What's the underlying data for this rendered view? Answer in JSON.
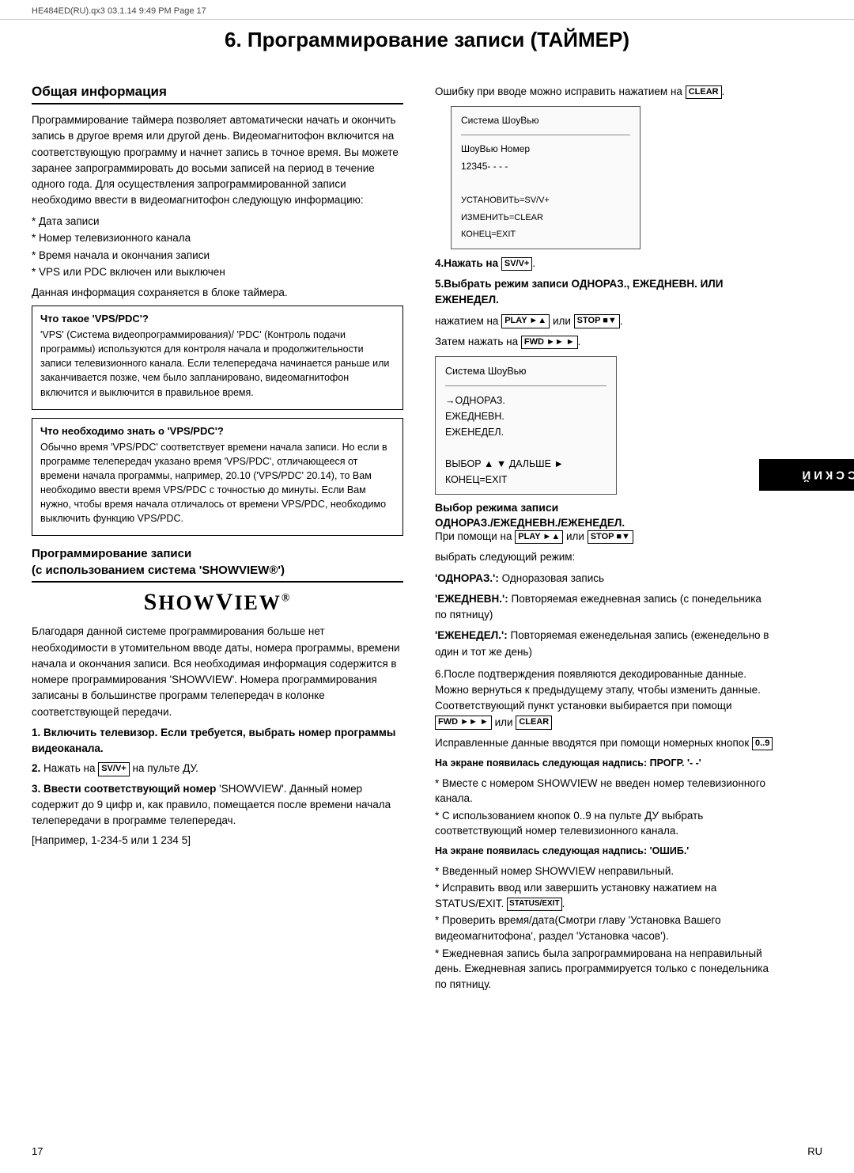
{
  "header": {
    "left": "HE484ED(RU).qx3  03.1.14  9:49 PM  Page 17",
    "right": ""
  },
  "chapter_title": "6. Программирование записи (ТАЙМЕР)",
  "left_col": {
    "section1_heading": "Общая информация",
    "section1_text": "Программирование таймера позволяет автоматически начать и окончить запись в другое время или другой день. Видеомагнитофон включится на соответствующую программу и начнет запись в точное время. Вы можете заранее запрограммировать до восьми записей на период в течение одного года. Для осуществления запрограммированной записи необходимо ввести в видеомагнитофон следующую информацию:",
    "star_items": [
      "Дата записи",
      "Номер телевизионного канала",
      "Время начала и окончания записи",
      "VPS или PDC включен или выключен"
    ],
    "section1_note": "Данная информация сохраняется в блоке таймера.",
    "subbox1_title": "Что такое 'VPS/PDC'?",
    "subbox1_text": "'VPS' (Система видеопрограммирования)/ 'PDC' (Контроль подачи программы) используются для контроля начала и продолжительности записи телевизионного канала. Если телепередача начинается раньше или заканчивается позже, чем было запланировано, видеомагнитофон включится и выключится в правильное время.",
    "subbox2_title": "Что необходимо знать о 'VPS/PDC'?",
    "subbox2_text": "Обычно время 'VPS/PDC' соответствует времени начала записи. Но если в программе телепередач указано время 'VPS/PDC', отличающееся от времени начала программы, например, 20.10 ('VPS/PDC' 20.14), то Вам необходимо ввести время VPS/PDC с точностью до минуты. Если Вам нужно, чтобы время начала отличалось от времени VPS/PDC, необходимо выключить функцию VPS/PDC.",
    "prog_section_title1": "Программирование записи",
    "prog_section_title2": "(с использованием система 'SHOWVIEW®')",
    "showview_logo": "ShowView",
    "showview_text": "Благодаря данной системе программирования больше нет необходимости в утомительном вводе даты, номера программы, времени начала и окончания записи. Вся необходимая информация содержится в номере программирования 'SHOWVIEW'. Номера программирования записаны в большинстве программ телепередач в колонке соответствующей передачи.",
    "steps": [
      {
        "num": "1.",
        "bold": "Включить телевизор. Если требуется, выбрать номер программы видеоканала."
      },
      {
        "num": "2.",
        "text_before_key": "Нажать на ",
        "key": "SV/V+",
        "text_after_key": " на пульте ДУ."
      },
      {
        "num": "3.",
        "bold": "Ввести соответствующий номер",
        "text": "'SHOWVIEW'. Данный номер содержит до 9 цифр и, как правило, помещается после времени начала телепередачи в программе телепередач."
      },
      {
        "num": "example",
        "text": "[Например, 1-234-5 или 1 234 5]"
      }
    ]
  },
  "right_col": {
    "clear_intro": "Ошибку при вводе можно исправить нажатием на",
    "clear_key": "CLEAR",
    "screen1": {
      "title": "Система ШоуВью",
      "line1": "ШоуВью Номер",
      "line2": "12345- - - -",
      "line3": "",
      "line4": "УСТАНОВИТЬ=SV/V+",
      "line5": "ИЗМЕНИТЬ=CLEAR",
      "line6": "КОНЕЦ=EXIT"
    },
    "step4": "4.Нажать на",
    "step4_key": "SV/V+",
    "step5_bold": "5.Выбрать режим записи ОДНОРАЗ., ЕЖЕДНЕВН. ИЛИ ЕЖЕНЕДЕЛ.",
    "step5_text": "нажатием на",
    "step5_key1": "PLAY ►▲",
    "step5_or": "или",
    "step5_key2": "STOP ■▼",
    "step5_then": "Затем нажать на",
    "step5_key3": "FWD ►► ►",
    "screen2": {
      "title": "Система ШоуВью",
      "line1": "→ОДНОРАЗ.",
      "line2": "ЕЖЕДНЕВН.",
      "line3": "ЕЖЕНЕДЕЛ.",
      "line4": "",
      "line5": "ВЫБОР ▲ ▼  ДАЛЬШЕ ►",
      "line6": "КОНЕЦ=EXIT"
    },
    "choice_title": "Выбор режима записи",
    "choice_subtitle": "ОДНОРАЗ./ЕЖЕДНЕВН./ЕЖЕНЕДЕЛ.",
    "choice_text": "При помощи на",
    "choice_key1": "PLAY ►▲",
    "choice_or": "или",
    "choice_key2": "STOP ■▼",
    "choice_select": "выбрать следующий режим:",
    "choice_items": [
      {
        "key": "'ОДНОРАЗ.':",
        "val": "Одноразовая запись"
      },
      {
        "key": "'ЕЖЕДНЕВН.':",
        "val": "Повторяемая ежедневная запись (с понедельника по пятницу)"
      },
      {
        "key": "'ЕЖЕНЕДЕЛ.':",
        "val": "Повторяемая еженедельная запись (еженедельно в один и тот же день)"
      }
    ],
    "step6_text": "6.После подтверждения появляются декодированные данные. Можно вернуться к предыдущему этапу, чтобы изменить данные. Соответствующий пункт установки выбирается при помощи",
    "step6_key1": "FWD ►► ►",
    "step6_or": "или",
    "step6_key2": "CLEAR",
    "step6_text2": "Исправленные данные вводятся при помощи номерных кнопок",
    "step6_key3": "0..9",
    "note1_bold": "На экране появилась следующая надпись: ПРОГР. '- -'",
    "note1_items": [
      "Вместе с номером SHOWVIEW не введен номер телевизионного канала.",
      "С использованием кнопок 0..9 на пульте ДУ выбрать соответствующий номер телевизионного канала."
    ],
    "note2_bold": "На экране появилась следующая надпись: 'ОШИБ.'",
    "note2_items": [
      "Введенный номер SHOWVIEW неправильный.",
      "Исправить ввод или завершить установку нажатием на STATUS/EXIT.",
      "Проверить время/дата(Смотри главу 'Установка Вашего видеомагнитофона', раздел 'Установка часов').",
      "Ежедневная запись была запрограммирована на неправильный день. Ежедневная запись программируется только с понедельника по пятницу."
    ]
  },
  "side_label": "РУССКИЙ",
  "page_number": "17",
  "page_label_right": "RU"
}
